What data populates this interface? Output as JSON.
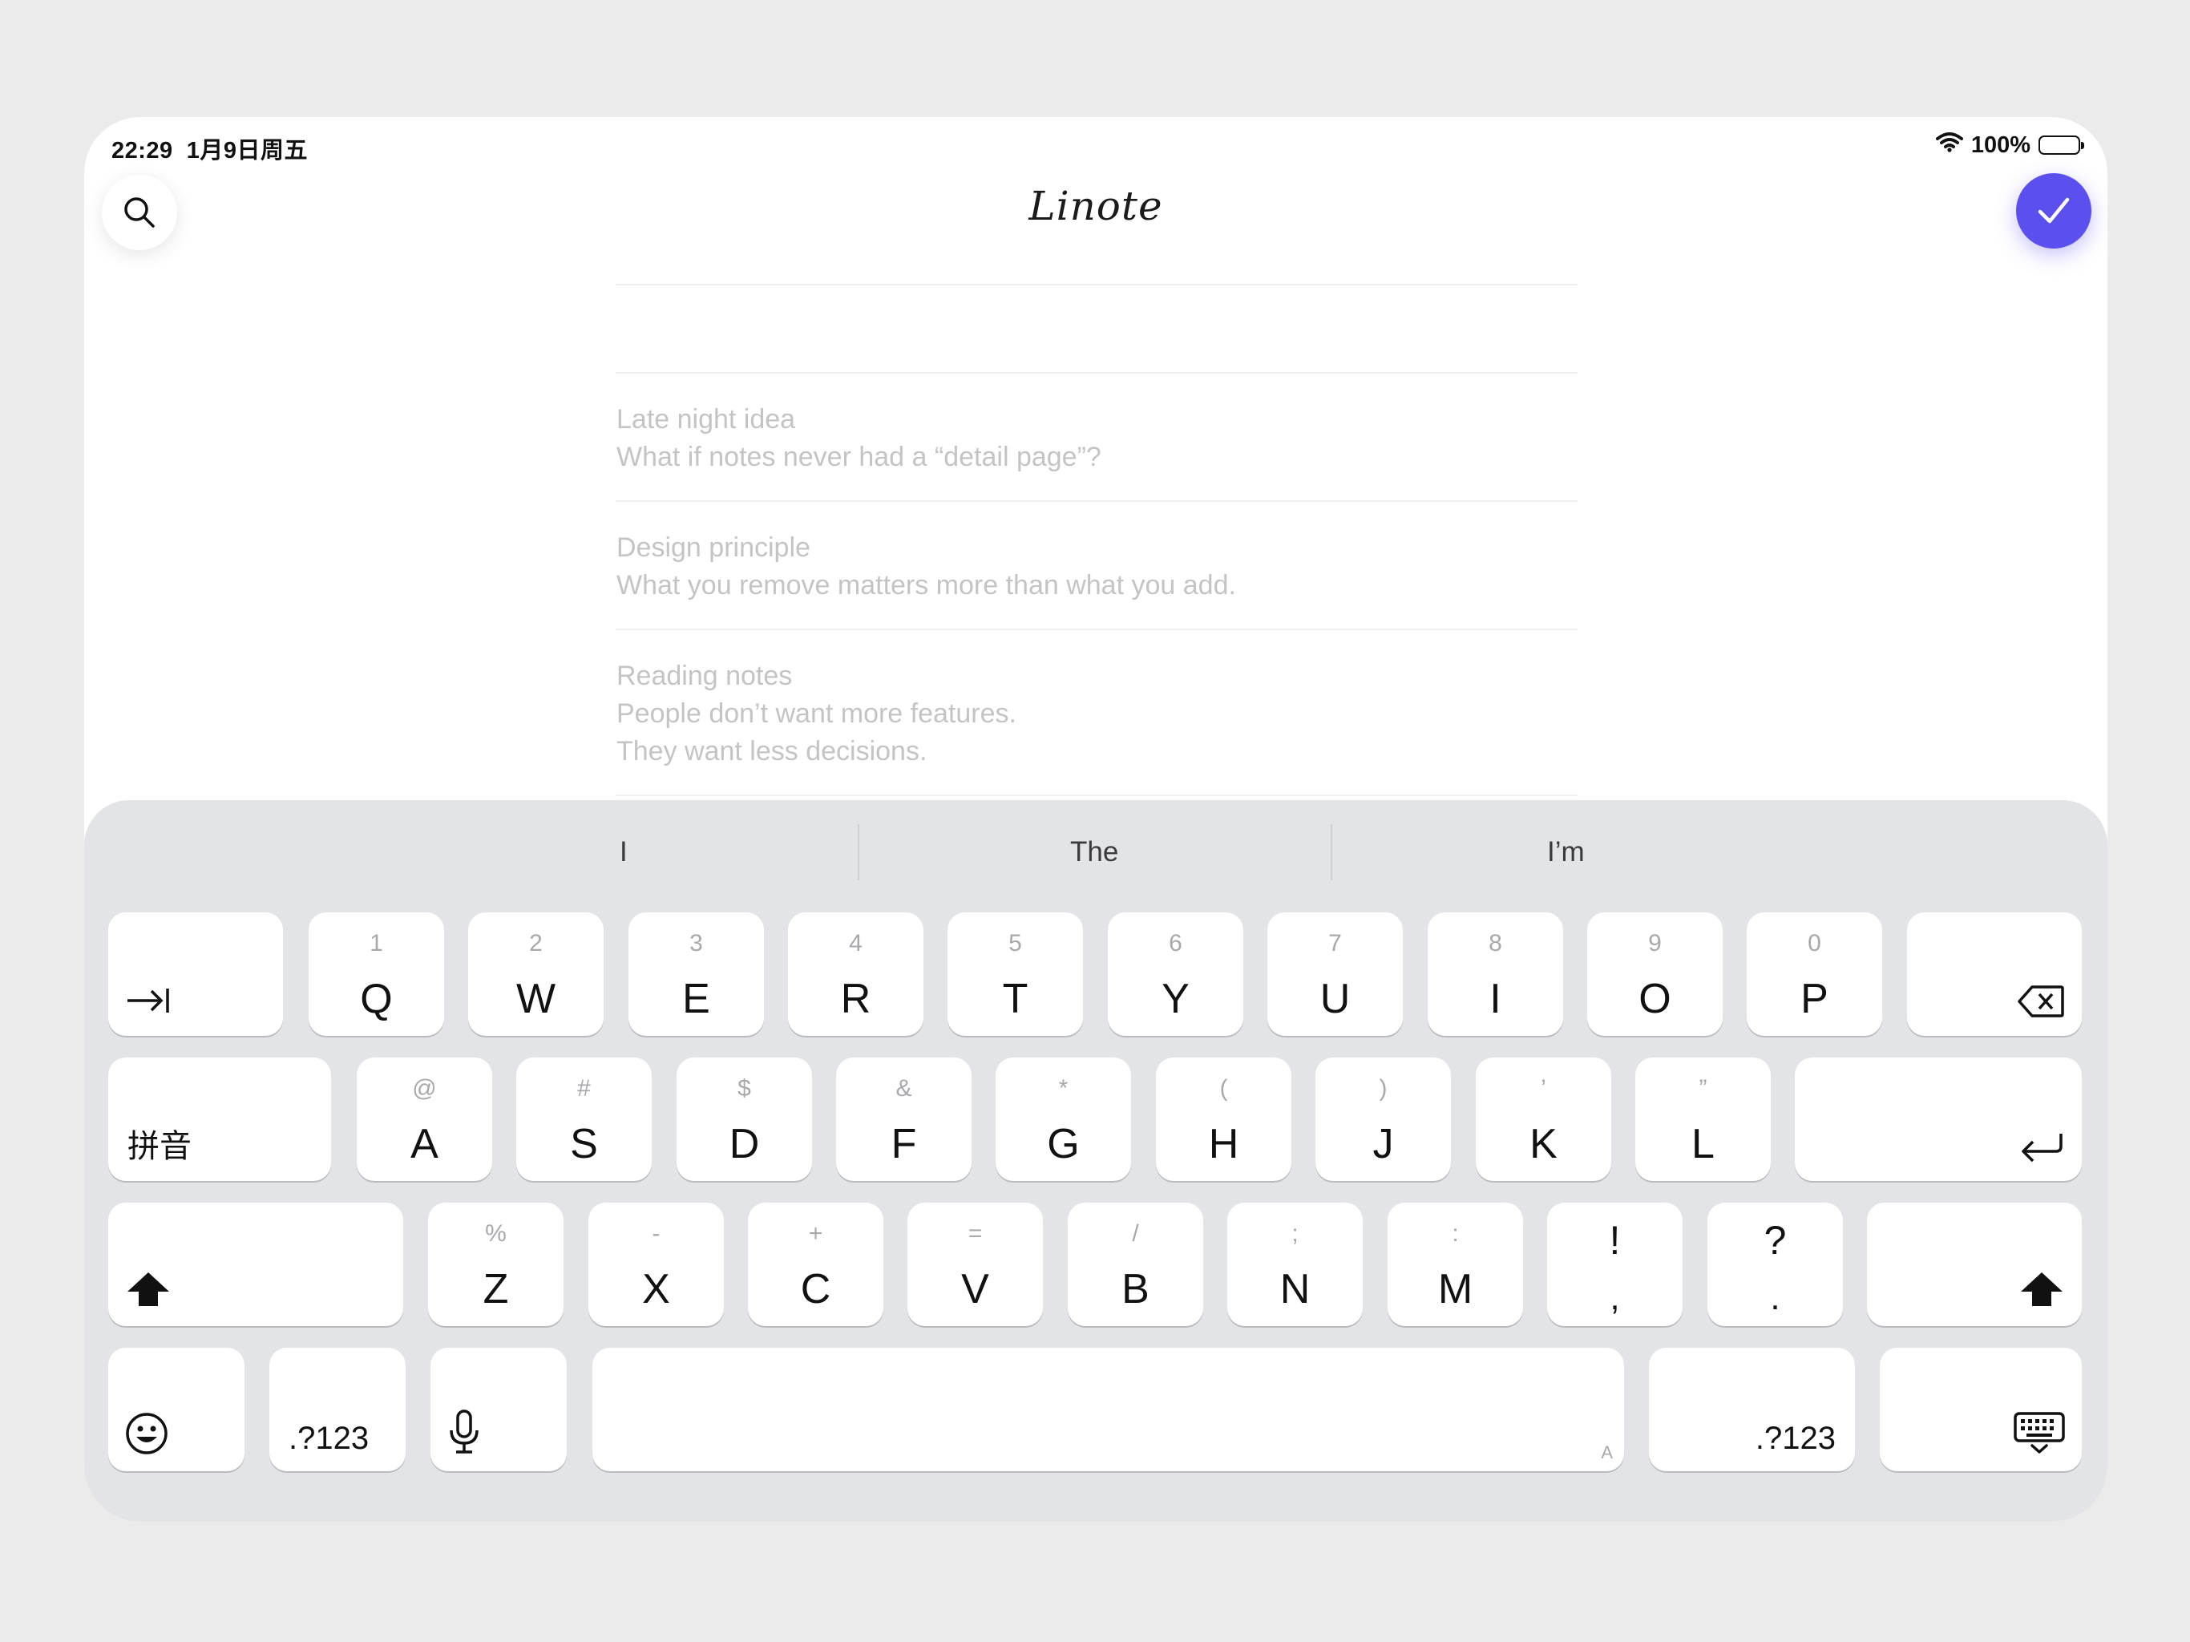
{
  "status": {
    "time": "22:29",
    "date": "1月9日周五",
    "battery": "100%",
    "battery_level": 1.0
  },
  "header": {
    "logo": "Linote"
  },
  "editor": {
    "value": ""
  },
  "notes": [
    {
      "lines": [
        "Late night idea",
        "What if notes never had a “detail page”?"
      ]
    },
    {
      "lines": [
        "Design principle",
        "What you remove matters more than what you add."
      ]
    },
    {
      "lines": [
        "Reading notes",
        "People don’t want more features.",
        "They want less decisions."
      ]
    }
  ],
  "keyboard": {
    "suggestions": [
      "I",
      "The",
      "I’m"
    ],
    "row1": [
      {
        "sub": "1",
        "key": "Q"
      },
      {
        "sub": "2",
        "key": "W"
      },
      {
        "sub": "3",
        "key": "E"
      },
      {
        "sub": "4",
        "key": "R"
      },
      {
        "sub": "5",
        "key": "T"
      },
      {
        "sub": "6",
        "key": "Y"
      },
      {
        "sub": "7",
        "key": "U"
      },
      {
        "sub": "8",
        "key": "I"
      },
      {
        "sub": "9",
        "key": "O"
      },
      {
        "sub": "0",
        "key": "P"
      }
    ],
    "row2": [
      {
        "sub": "@",
        "key": "A"
      },
      {
        "sub": "#",
        "key": "S"
      },
      {
        "sub": "$",
        "key": "D"
      },
      {
        "sub": "&",
        "key": "F"
      },
      {
        "sub": "*",
        "key": "G"
      },
      {
        "sub": "(",
        "key": "H"
      },
      {
        "sub": ")",
        "key": "J"
      },
      {
        "sub": "’",
        "key": "K"
      },
      {
        "sub": "”",
        "key": "L"
      }
    ],
    "row3": [
      {
        "sub": "%",
        "key": "Z"
      },
      {
        "sub": "-",
        "key": "X"
      },
      {
        "sub": "+",
        "key": "C"
      },
      {
        "sub": "=",
        "key": "V"
      },
      {
        "sub": "/",
        "key": "B"
      },
      {
        "sub": ";",
        "key": "N"
      },
      {
        "sub": ":",
        "key": "M"
      }
    ],
    "punct": [
      {
        "top": "!",
        "bottom": ","
      },
      {
        "top": "?",
        "bottom": "."
      }
    ],
    "pinyin_label": "拼音",
    "numbers_left": ".?123",
    "numbers_right": ".?123",
    "space_hint": "A",
    "icons": {
      "tab": "tab-icon",
      "delete": "delete-icon",
      "return": "return-icon",
      "shift": "shift-icon",
      "emoji": "emoji-icon",
      "mic": "microphone-icon",
      "hide": "keyboard-hide-icon"
    }
  },
  "colors": {
    "accent": "#5b4ff0",
    "caret": "#7a6cf3",
    "keyboard_bg": "#e3e4e8"
  }
}
